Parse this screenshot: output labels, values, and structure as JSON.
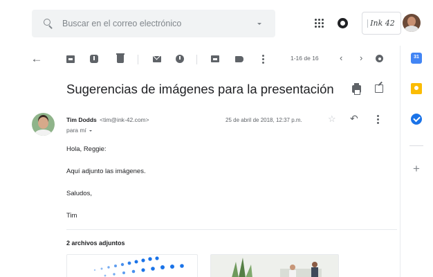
{
  "search": {
    "placeholder": "Buscar en el correo electrónico"
  },
  "header": {
    "brand": "Ink 42"
  },
  "toolbar": {
    "count": "1-16 de 16"
  },
  "email": {
    "subject": "Sugerencias de imágenes para la presentación",
    "sender_name": "Tim Dodds",
    "sender_email": "<tim@ink-42.com>",
    "recipient": "para mí",
    "date": "25 de abril de 2018, 12:37 p.m.",
    "body": [
      "Hola, Reggie:",
      "Aquí adjunto las imágenes.",
      "Saludos,",
      "Tim"
    ]
  },
  "attachments": {
    "title": "2 archivos adjuntos"
  },
  "colors": {
    "accent": "#1a73e8",
    "search_bg": "#f1f3f4",
    "icon": "#5f6368",
    "calendar": "#4285f4",
    "keep": "#fbbc04"
  },
  "icons": {
    "toolbar": [
      "back-arrow-icon",
      "archive-icon",
      "report-spam-icon",
      "delete-icon",
      "mark-unread-icon",
      "snooze-icon",
      "move-to-icon",
      "label-icon",
      "more-icon",
      "prev-icon",
      "next-icon",
      "settings-icon"
    ],
    "side_panel": [
      "calendar-icon",
      "keep-icon",
      "tasks-icon",
      "add-icon"
    ]
  }
}
